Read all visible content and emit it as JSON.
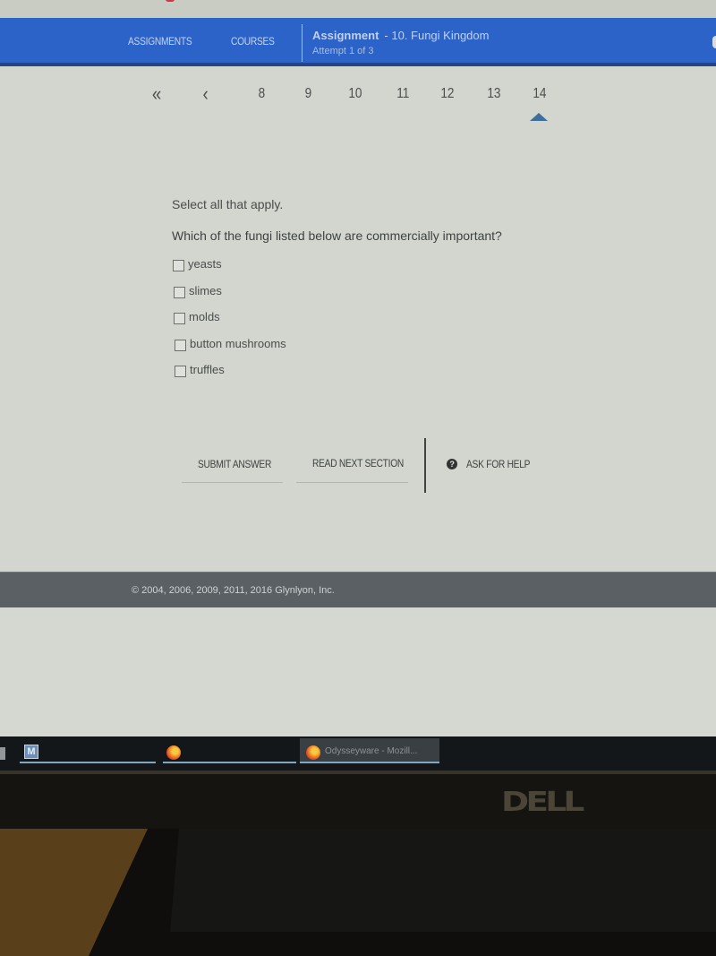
{
  "header": {
    "nav": [
      {
        "label": "ASSIGNMENTS"
      },
      {
        "label": "COURSES"
      }
    ],
    "assignment_label": "Assignment",
    "assignment_name": "- 10. Fungi Kingdom",
    "attempt": "Attempt 1 of 3"
  },
  "pager": {
    "first_icon": "double-chevron-left-icon",
    "first_glyph": "«",
    "prev_icon": "chevron-left-icon",
    "prev_glyph": "‹",
    "pages": [
      "8",
      "9",
      "10",
      "11",
      "12",
      "13",
      "14"
    ],
    "current_page": "14"
  },
  "question": {
    "instructions": "Select all that apply.",
    "prompt": "Which of the fungi listed below are commercially important?",
    "options": [
      {
        "label": "yeasts",
        "checked": false
      },
      {
        "label": "slimes",
        "checked": false
      },
      {
        "label": "molds",
        "checked": false
      },
      {
        "label": "button mushrooms",
        "checked": false
      },
      {
        "label": "truffles",
        "checked": false
      }
    ]
  },
  "actions": {
    "submit_label": "SUBMIT ANSWER",
    "next_label": "READ NEXT SECTION",
    "help_label": "ASK FOR HELP",
    "help_icon": "question-circle-icon",
    "help_glyph": "?"
  },
  "footer": {
    "copyright": "© 2004, 2006, 2009, 2011, 2016 Glynlyon, Inc."
  },
  "taskbar": {
    "items": [
      {
        "icon": "m-app-icon",
        "glyph": "M",
        "label": ""
      },
      {
        "icon": "firefox-icon",
        "label": ""
      },
      {
        "icon": "firefox-icon",
        "label": "Odysseyware - Mozill..."
      }
    ]
  },
  "monitor": {
    "brand": "DELL"
  },
  "colors": {
    "header_blue": "#2c63c9",
    "footer_gray": "#5a6064",
    "current_page_marker": "#3f6e9c"
  }
}
